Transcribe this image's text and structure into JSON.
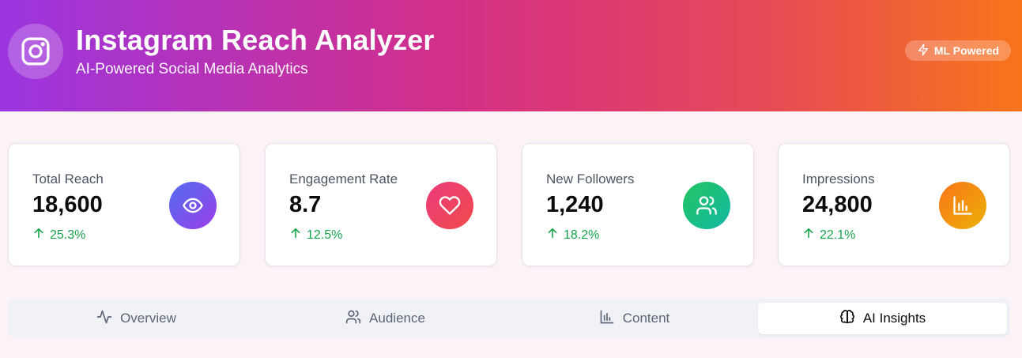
{
  "header": {
    "title": "Instagram Reach Analyzer",
    "subtitle": "AI-Powered Social Media Analytics",
    "badge": "ML Powered",
    "logo_icon": "instagram-icon",
    "badge_icon": "lightning-icon"
  },
  "metrics": [
    {
      "label": "Total Reach",
      "value": "18,600",
      "trend": "25.3%",
      "icon": "eye-icon",
      "gradient": [
        "#4f6ef0",
        "#9d3ee8"
      ]
    },
    {
      "label": "Engagement Rate",
      "value": "8.7",
      "trend": "12.5%",
      "icon": "heart-icon",
      "gradient": [
        "#ec3b7c",
        "#f04a4a"
      ]
    },
    {
      "label": "New Followers",
      "value": "1,240",
      "trend": "18.2%",
      "icon": "users-icon",
      "gradient": [
        "#22c55e",
        "#14b8a6"
      ]
    },
    {
      "label": "Impressions",
      "value": "24,800",
      "trend": "22.1%",
      "icon": "bar-chart-icon",
      "gradient": [
        "#f97316",
        "#eab308"
      ]
    }
  ],
  "tabs": [
    {
      "label": "Overview",
      "icon": "activity-icon",
      "active": false
    },
    {
      "label": "Audience",
      "icon": "users-icon",
      "active": false
    },
    {
      "label": "Content",
      "icon": "bar-chart-icon",
      "active": false
    },
    {
      "label": "AI Insights",
      "icon": "brain-icon",
      "active": true
    }
  ],
  "colors": {
    "trend_up": "#16a34a",
    "header_gradient": [
      "#9b35e0",
      "#d42f86",
      "#e64a56",
      "#f9741a"
    ]
  }
}
